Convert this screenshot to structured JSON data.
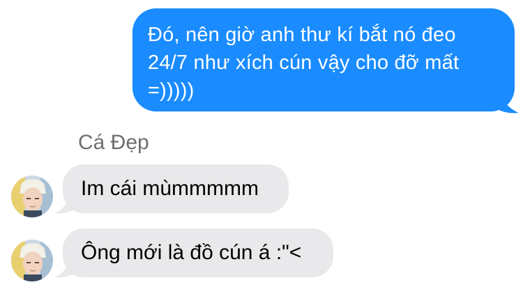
{
  "outgoing_message": {
    "lines": [
      "Đó, nên giờ anh thư kí bắt nó đeo",
      "24/7 như xích cún vậy cho đỡ mất",
      "=)))))"
    ],
    "bubble_color": "#1a8cff"
  },
  "incoming_sender": {
    "name": "Cá Đẹp"
  },
  "incoming_messages": [
    {
      "text": "Im cái mùmmmmm"
    },
    {
      "text": "Ông mới là đồ cún á :\"<"
    }
  ],
  "incoming_bubble_color": "#e9e9eb"
}
